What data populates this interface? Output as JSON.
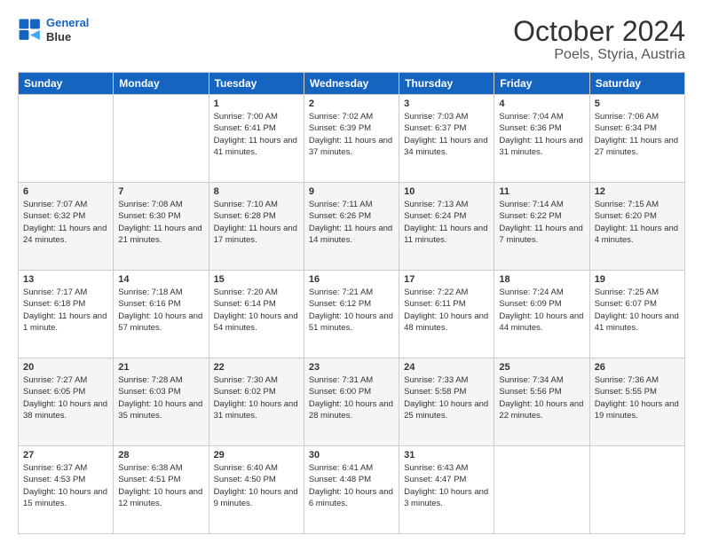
{
  "logo": {
    "line1": "General",
    "line2": "Blue"
  },
  "title": "October 2024",
  "subtitle": "Poels, Styria, Austria",
  "weekdays": [
    "Sunday",
    "Monday",
    "Tuesday",
    "Wednesday",
    "Thursday",
    "Friday",
    "Saturday"
  ],
  "weeks": [
    [
      {
        "num": "",
        "info": ""
      },
      {
        "num": "",
        "info": ""
      },
      {
        "num": "1",
        "info": "Sunrise: 7:00 AM\nSunset: 6:41 PM\nDaylight: 11 hours and 41 minutes."
      },
      {
        "num": "2",
        "info": "Sunrise: 7:02 AM\nSunset: 6:39 PM\nDaylight: 11 hours and 37 minutes."
      },
      {
        "num": "3",
        "info": "Sunrise: 7:03 AM\nSunset: 6:37 PM\nDaylight: 11 hours and 34 minutes."
      },
      {
        "num": "4",
        "info": "Sunrise: 7:04 AM\nSunset: 6:36 PM\nDaylight: 11 hours and 31 minutes."
      },
      {
        "num": "5",
        "info": "Sunrise: 7:06 AM\nSunset: 6:34 PM\nDaylight: 11 hours and 27 minutes."
      }
    ],
    [
      {
        "num": "6",
        "info": "Sunrise: 7:07 AM\nSunset: 6:32 PM\nDaylight: 11 hours and 24 minutes."
      },
      {
        "num": "7",
        "info": "Sunrise: 7:08 AM\nSunset: 6:30 PM\nDaylight: 11 hours and 21 minutes."
      },
      {
        "num": "8",
        "info": "Sunrise: 7:10 AM\nSunset: 6:28 PM\nDaylight: 11 hours and 17 minutes."
      },
      {
        "num": "9",
        "info": "Sunrise: 7:11 AM\nSunset: 6:26 PM\nDaylight: 11 hours and 14 minutes."
      },
      {
        "num": "10",
        "info": "Sunrise: 7:13 AM\nSunset: 6:24 PM\nDaylight: 11 hours and 11 minutes."
      },
      {
        "num": "11",
        "info": "Sunrise: 7:14 AM\nSunset: 6:22 PM\nDaylight: 11 hours and 7 minutes."
      },
      {
        "num": "12",
        "info": "Sunrise: 7:15 AM\nSunset: 6:20 PM\nDaylight: 11 hours and 4 minutes."
      }
    ],
    [
      {
        "num": "13",
        "info": "Sunrise: 7:17 AM\nSunset: 6:18 PM\nDaylight: 11 hours and 1 minute."
      },
      {
        "num": "14",
        "info": "Sunrise: 7:18 AM\nSunset: 6:16 PM\nDaylight: 10 hours and 57 minutes."
      },
      {
        "num": "15",
        "info": "Sunrise: 7:20 AM\nSunset: 6:14 PM\nDaylight: 10 hours and 54 minutes."
      },
      {
        "num": "16",
        "info": "Sunrise: 7:21 AM\nSunset: 6:12 PM\nDaylight: 10 hours and 51 minutes."
      },
      {
        "num": "17",
        "info": "Sunrise: 7:22 AM\nSunset: 6:11 PM\nDaylight: 10 hours and 48 minutes."
      },
      {
        "num": "18",
        "info": "Sunrise: 7:24 AM\nSunset: 6:09 PM\nDaylight: 10 hours and 44 minutes."
      },
      {
        "num": "19",
        "info": "Sunrise: 7:25 AM\nSunset: 6:07 PM\nDaylight: 10 hours and 41 minutes."
      }
    ],
    [
      {
        "num": "20",
        "info": "Sunrise: 7:27 AM\nSunset: 6:05 PM\nDaylight: 10 hours and 38 minutes."
      },
      {
        "num": "21",
        "info": "Sunrise: 7:28 AM\nSunset: 6:03 PM\nDaylight: 10 hours and 35 minutes."
      },
      {
        "num": "22",
        "info": "Sunrise: 7:30 AM\nSunset: 6:02 PM\nDaylight: 10 hours and 31 minutes."
      },
      {
        "num": "23",
        "info": "Sunrise: 7:31 AM\nSunset: 6:00 PM\nDaylight: 10 hours and 28 minutes."
      },
      {
        "num": "24",
        "info": "Sunrise: 7:33 AM\nSunset: 5:58 PM\nDaylight: 10 hours and 25 minutes."
      },
      {
        "num": "25",
        "info": "Sunrise: 7:34 AM\nSunset: 5:56 PM\nDaylight: 10 hours and 22 minutes."
      },
      {
        "num": "26",
        "info": "Sunrise: 7:36 AM\nSunset: 5:55 PM\nDaylight: 10 hours and 19 minutes."
      }
    ],
    [
      {
        "num": "27",
        "info": "Sunrise: 6:37 AM\nSunset: 4:53 PM\nDaylight: 10 hours and 15 minutes."
      },
      {
        "num": "28",
        "info": "Sunrise: 6:38 AM\nSunset: 4:51 PM\nDaylight: 10 hours and 12 minutes."
      },
      {
        "num": "29",
        "info": "Sunrise: 6:40 AM\nSunset: 4:50 PM\nDaylight: 10 hours and 9 minutes."
      },
      {
        "num": "30",
        "info": "Sunrise: 6:41 AM\nSunset: 4:48 PM\nDaylight: 10 hours and 6 minutes."
      },
      {
        "num": "31",
        "info": "Sunrise: 6:43 AM\nSunset: 4:47 PM\nDaylight: 10 hours and 3 minutes."
      },
      {
        "num": "",
        "info": ""
      },
      {
        "num": "",
        "info": ""
      }
    ]
  ],
  "labels": {
    "sunday": "Sunday",
    "monday": "Monday",
    "tuesday": "Tuesday",
    "wednesday": "Wednesday",
    "thursday": "Thursday",
    "friday": "Friday",
    "saturday": "Saturday"
  }
}
